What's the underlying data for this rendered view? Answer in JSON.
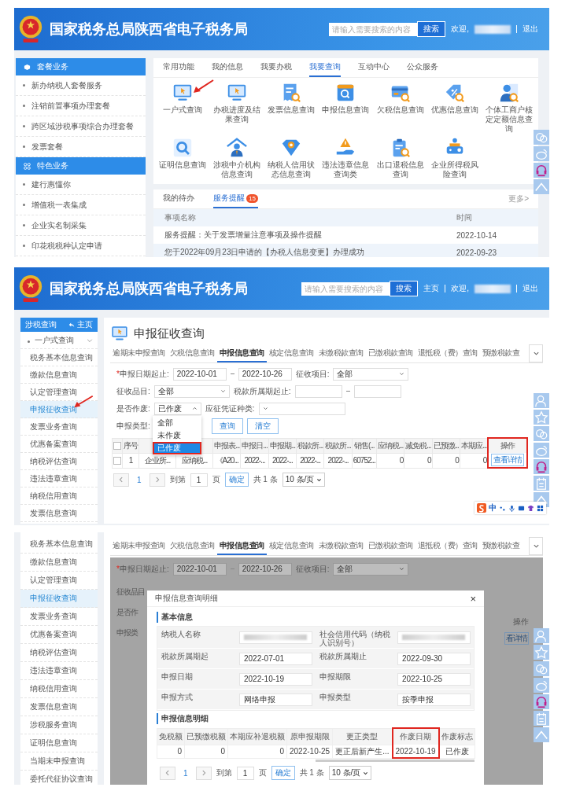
{
  "portal": {
    "header": {
      "title": "国家税务总局陕西省电子税务局",
      "search_placeholder": "请输入需要搜索的内容",
      "search_button": "搜索",
      "greeting": "欢迎,",
      "logout": "退出"
    },
    "sidebar": [
      {
        "title": "套餐业务",
        "items": [
          "新办纳税人套餐服务",
          "注销前置事项办理套餐",
          "跨区域涉税事项综合办理套餐",
          "发票套餐"
        ]
      },
      {
        "title": "特色业务",
        "items": [
          "建行惠懂你",
          "增值税一表集成",
          "企业实名制采集",
          "印花税税种认定申请"
        ]
      }
    ],
    "tabs": [
      {
        "label": "常用功能",
        "selected": false
      },
      {
        "label": "我的信息",
        "selected": false
      },
      {
        "label": "我要办税",
        "selected": false
      },
      {
        "label": "我要查询",
        "selected": true
      },
      {
        "label": "互动中心",
        "selected": false
      },
      {
        "label": "公众服务",
        "selected": false
      }
    ],
    "functions": [
      {
        "label": "一户式查询",
        "annotated": true
      },
      {
        "label": "办税进度及结果查询",
        "annotated": false
      },
      {
        "label": "发票信息查询",
        "annotated": false
      },
      {
        "label": "申报信息查询",
        "annotated": false
      },
      {
        "label": "欠税信息查询",
        "annotated": false
      },
      {
        "label": "优惠信息查询",
        "annotated": false
      },
      {
        "label": "个体工商户核定定额信息查询",
        "annotated": false
      },
      {
        "label": "证明信息查询",
        "annotated": false
      },
      {
        "label": "涉税中介机构信息查询",
        "annotated": false
      },
      {
        "label": "纳税人信用状态信息查询",
        "annotated": false
      },
      {
        "label": "违法违章信息查询类",
        "annotated": false
      },
      {
        "label": "出口退税信息查询",
        "annotated": false
      },
      {
        "label": "企业所得税风险查询",
        "annotated": false
      }
    ],
    "notice_tabs": [
      {
        "label": "我的待办",
        "selected": false
      },
      {
        "label": "服务提醒",
        "selected": true,
        "badge": "15"
      }
    ],
    "more": "更多>",
    "notice_columns": [
      "事项名称",
      "时间"
    ],
    "notices": [
      {
        "title": "服务提醒：关于发票增量注意事项及操作提醒",
        "time": "2022-10-14"
      },
      {
        "title": "您于2022年09月23日申请的【办税人信息变更】办理成功",
        "time": "2022-09-23"
      }
    ]
  },
  "query_page": {
    "header": {
      "title": "国家税务总局陕西省电子税务局",
      "search_placeholder": "请输入需要搜索的内容",
      "search_button": "搜索",
      "home": "主页",
      "greeting": "欢迎,",
      "logout": "退出"
    },
    "sidebar": {
      "title": "涉税查询",
      "home": "主页",
      "group": {
        "label": "一户式查询",
        "expanded": true,
        "children": [
          {
            "label": "税务基本信息查询",
            "selected": false,
            "annotated": false
          },
          {
            "label": "缴款信息查询",
            "selected": false,
            "annotated": false
          },
          {
            "label": "认定管理查询",
            "selected": false,
            "annotated": false
          },
          {
            "label": "申报征收查询",
            "selected": true,
            "annotated": true
          },
          {
            "label": "发票业务查询",
            "selected": false,
            "annotated": false
          },
          {
            "label": "优惠备案查询",
            "selected": false,
            "annotated": false
          },
          {
            "label": "纳税评估查询",
            "selected": false,
            "annotated": false
          },
          {
            "label": "违法违章查询",
            "selected": false,
            "annotated": false
          },
          {
            "label": "纳税信用查询",
            "selected": false,
            "annotated": false
          },
          {
            "label": "发票信息查询",
            "selected": false,
            "annotated": false
          }
        ]
      }
    },
    "page_title": "申报征收查询",
    "tabs": [
      {
        "label": "逾期未申报查询",
        "selected": false
      },
      {
        "label": "欠税信息查询",
        "selected": false
      },
      {
        "label": "申报信息查询",
        "selected": true
      },
      {
        "label": "核定信息查询",
        "selected": false
      },
      {
        "label": "未缴税款查询",
        "selected": false
      },
      {
        "label": "已缴税款查询",
        "selected": false
      },
      {
        "label": "退抵税（费）查询",
        "selected": false
      },
      {
        "label": "预缴税款查",
        "selected": false
      }
    ],
    "form": {
      "required_mark": "*",
      "date_label": "申报日期起止:",
      "date_from": "2022-10-01",
      "date_to": "2022-10-26",
      "item_label": "征收项目:",
      "item_value": "全部",
      "subitem_label": "征收品目:",
      "subitem_value": "全部",
      "period_label": "税款所属期起止:",
      "void_label": "是否作废:",
      "void_value": "已作废",
      "void_open": true,
      "void_options": [
        {
          "label": "全部",
          "selected": false,
          "highlighted": false
        },
        {
          "label": "未作废",
          "selected": false,
          "highlighted": false
        },
        {
          "label": "已作废",
          "selected": true,
          "highlighted": true
        }
      ],
      "voucher_label": "应征凭证种类:",
      "type_label": "申报类型:",
      "query_button": "查询",
      "clear_button": "清空"
    },
    "table": {
      "header_checked": false,
      "columns": [
        {
          "kind": "text",
          "label": "序号",
          "highlighted": false
        },
        {
          "kind": "text",
          "highlighted": false
        },
        {
          "kind": "text",
          "highlighted": false
        },
        {
          "kind": "text",
          "label": "申报表...",
          "highlighted": false
        },
        {
          "kind": "text",
          "label": "申报日...",
          "highlighted": false
        },
        {
          "kind": "text",
          "label": "申报期...",
          "highlighted": false
        },
        {
          "kind": "text",
          "label": "税款所...",
          "highlighted": false
        },
        {
          "kind": "text",
          "label": "税款所...",
          "highlighted": false
        },
        {
          "kind": "text",
          "label": "销售(...",
          "highlighted": false
        },
        {
          "kind": "text",
          "label": "应纳税...",
          "highlighted": false
        },
        {
          "kind": "text",
          "label": "减免税...",
          "highlighted": false
        },
        {
          "kind": "text",
          "label": "已预缴...",
          "highlighted": false
        },
        {
          "kind": "text",
          "label": "本期应...",
          "highlighted": false
        },
        {
          "kind": "action",
          "label": "操作",
          "highlighted": true
        }
      ],
      "rows": [
        {
          "checked": false,
          "cells": [
            "1",
            "企业所...",
            "应纳税...",
            "《A20...",
            "2022-...",
            "2022-...",
            "2022-...",
            "2022-...",
            "60752...",
            "0",
            "0",
            "0",
            "0"
          ],
          "action": "查看详情"
        }
      ]
    },
    "pagination": {
      "page": "1",
      "goto_label": "到第",
      "goto_value": "1",
      "page_unit": "页",
      "confirm": "确定",
      "total": "共 1 条",
      "page_size": "10 条/页"
    },
    "ime": {
      "mode": "中"
    }
  },
  "detail_view": {
    "sidebar": [
      {
        "label": "税务基本信息查询",
        "selected": false
      },
      {
        "label": "缴款信息查询",
        "selected": false
      },
      {
        "label": "认定管理查询",
        "selected": false
      },
      {
        "label": "申报征收查询",
        "selected": true
      },
      {
        "label": "发票业务查询",
        "selected": false
      },
      {
        "label": "优惠备案查询",
        "selected": false
      },
      {
        "label": "纳税评估查询",
        "selected": false
      },
      {
        "label": "违法违章查询",
        "selected": false
      },
      {
        "label": "纳税信用查询",
        "selected": false
      },
      {
        "label": "发票信息查询",
        "selected": false
      },
      {
        "label": "涉税服务查询",
        "selected": false
      },
      {
        "label": "证明信息查询",
        "selected": false
      },
      {
        "label": "当期未申报查询",
        "selected": false
      },
      {
        "label": "委托代征协议查询",
        "selected": false
      }
    ],
    "tabs": [
      {
        "label": "逾期未申报查询",
        "selected": false
      },
      {
        "label": "欠税信息查询",
        "selected": false
      },
      {
        "label": "申报信息查询",
        "selected": true
      },
      {
        "label": "核定信息查询",
        "selected": false
      },
      {
        "label": "未缴税款查询",
        "selected": false
      },
      {
        "label": "已缴税款查询",
        "selected": false
      },
      {
        "label": "退抵税（费）查询",
        "selected": false
      },
      {
        "label": "预缴税款查",
        "selected": false
      }
    ],
    "background": {
      "required_mark": "*",
      "date_label": "申报日期起止:",
      "date_from": "2022-10-01",
      "date_to": "2022-10-26",
      "item_label": "征收项目:",
      "item_value": "全部",
      "cut_labels": [
        "征收品目",
        "是否作",
        "申报类"
      ],
      "action_header": "操作",
      "action_button": "看详情"
    },
    "dialog": {
      "title": "申报信息查询明细",
      "close": "×",
      "basic_title": "基本信息",
      "basic_fields": [
        {
          "label": "纳税人名称",
          "redacted": true
        },
        {
          "label": "社会信用代码（纳税人识别号）",
          "redacted": true
        },
        {
          "label": "税款所属期起",
          "redacted": false,
          "value": "2022-07-01"
        },
        {
          "label": "税款所属期止",
          "redacted": false,
          "value": "2022-09-30"
        },
        {
          "label": "申报日期",
          "redacted": false,
          "value": "2022-10-19"
        },
        {
          "label": "申报期限",
          "redacted": false,
          "value": "2022-10-25"
        },
        {
          "label": "申报方式",
          "redacted": false,
          "value": "网络申报"
        },
        {
          "label": "申报类型",
          "redacted": false,
          "value": "按季申报"
        }
      ],
      "detail_title": "申报信息明细",
      "columns": [
        {
          "label": "免税额",
          "highlighted": false
        },
        {
          "label": "已预缴税额",
          "highlighted": false
        },
        {
          "label": "本期应补退税额",
          "highlighted": false
        },
        {
          "label": "原申报期限",
          "highlighted": false
        },
        {
          "label": "更正类型",
          "highlighted": false
        },
        {
          "label": "作废日期",
          "highlighted": true
        },
        {
          "label": "作废标志",
          "highlighted": false
        }
      ],
      "row": [
        "0",
        "0",
        "0",
        "2022-10-25",
        "更正后新产生...",
        "2022-10-19",
        "已作废"
      ],
      "pagination": {
        "page": "1",
        "goto_label": "到第",
        "goto_value": "1",
        "page_unit": "页",
        "confirm": "确定",
        "total": "共 1 条",
        "page_size": "10 条/页"
      }
    }
  }
}
